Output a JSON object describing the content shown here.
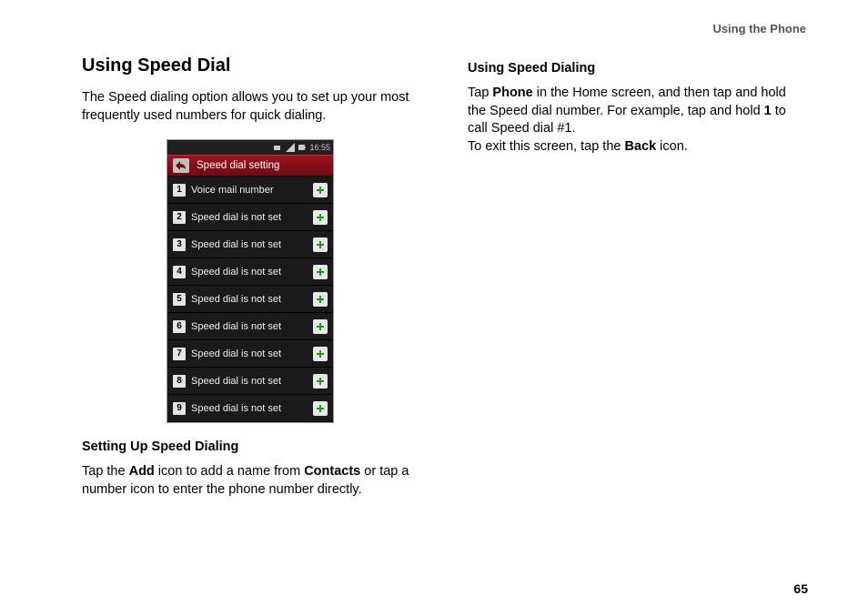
{
  "header": {
    "section": "Using the Phone"
  },
  "left": {
    "title": "Using Speed Dial",
    "intro": "The Speed dialing option allows you to set up your most frequently used numbers for quick dialing.",
    "sub_heading": "Setting Up Speed Dialing",
    "sub_text_1": "Tap the ",
    "sub_text_add": "Add",
    "sub_text_2": " icon to add a name from ",
    "sub_text_contacts": "Contacts",
    "sub_text_3": " or tap a number icon to enter the phone number directly."
  },
  "right": {
    "heading": "Using Speed Dialing",
    "p1a": "Tap ",
    "p1_phone": "Phone",
    "p1b": " in the Home screen, and then tap and hold the Speed dial number. For example, tap and hold ",
    "p1_one": "1",
    "p1c": " to call Speed dial #1.",
    "p2a": "To exit this screen, tap the ",
    "p2_back": "Back",
    "p2b": " icon."
  },
  "phone": {
    "time": "16:55",
    "title": "Speed dial setting",
    "rows": [
      {
        "n": "1",
        "label": "Voice mail number"
      },
      {
        "n": "2",
        "label": "Speed dial is not set"
      },
      {
        "n": "3",
        "label": "Speed dial is not set"
      },
      {
        "n": "4",
        "label": "Speed dial is not set"
      },
      {
        "n": "5",
        "label": "Speed dial is not set"
      },
      {
        "n": "6",
        "label": "Speed dial is not set"
      },
      {
        "n": "7",
        "label": "Speed dial is not set"
      },
      {
        "n": "8",
        "label": "Speed dial is not set"
      },
      {
        "n": "9",
        "label": "Speed dial is not set"
      }
    ]
  },
  "page_number": "65"
}
